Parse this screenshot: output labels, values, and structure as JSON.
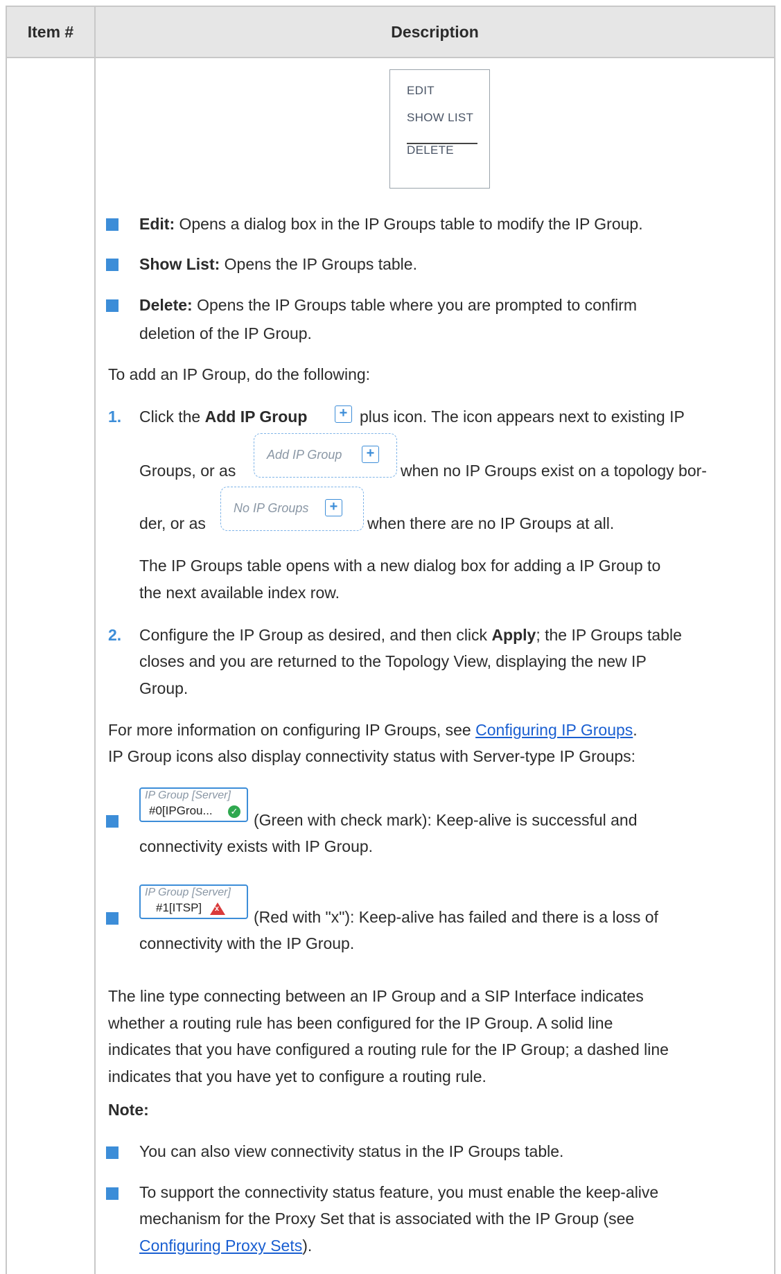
{
  "header": {
    "item": "Item #",
    "description": "Description"
  },
  "menu": {
    "edit": "EDIT",
    "show_list": "SHOW LIST",
    "delete": "DELETE"
  },
  "bullets1": [
    {
      "label": "Edit:",
      "text": " Opens a dialog box in the IP Groups table to modify the IP Group."
    },
    {
      "label": "Show List:",
      "text": " Opens the IP Groups table."
    },
    {
      "label": "Delete:",
      "text": " Opens the IP Groups table where you are prompted to confirm",
      "text2": "deletion of the IP Group."
    }
  ],
  "add_intro": "To add an IP Group, do the following:",
  "step1": {
    "num": "1.",
    "a": "Click the ",
    "bold": "Add IP Group",
    "b": " plus icon. The icon appears next to existing IP",
    "line2a": "Groups, or as",
    "line2b": "when no IP Groups exist on a topology bor-",
    "line3a": "der, or as",
    "line3b": "when there are no IP Groups at all.",
    "add_box_label": "Add IP Group",
    "no_box_label": "No IP Groups",
    "plus": "+",
    "para1": "The IP Groups table opens with a new dialog box for adding a IP Group to",
    "para2": "the next available index row."
  },
  "step2": {
    "num": "2.",
    "a": "Configure the IP Group as desired, and then click ",
    "bold": "Apply",
    "b": "; the IP Groups table",
    "line2": "closes and you are returned to the Topology View, displaying the new IP",
    "line3": "Group."
  },
  "more_info": {
    "text": "For more information on configuring IP Groups, see ",
    "link": "Configuring IP Groups",
    "end": "."
  },
  "icons_intro": "IP Group icons also display connectivity status with Server-type IP Groups:",
  "status": [
    {
      "icon_title": "IP Group [Server]",
      "icon_name": "#0[IPGrou...",
      "text": "(Green with check mark): Keep-alive is successful and",
      "text2": "connectivity exists with IP Group."
    },
    {
      "icon_title": "IP Group [Server]",
      "icon_name": "#1[ITSP]",
      "text": "(Red with \"x\"): Keep-alive has failed and there is a loss of",
      "text2": "connectivity with the IP Group."
    }
  ],
  "line_type": [
    "The line type connecting between an IP Group and a SIP Interface indicates",
    "whether a routing rule has been configured for the IP Group. A solid line",
    "indicates that you have configured a routing rule for the IP Group; a dashed line",
    "indicates that you have yet to configure a routing rule."
  ],
  "note_label": "Note:",
  "notes": [
    {
      "text": "You can also view connectivity status in the IP Groups table."
    },
    {
      "text": "To support the connectivity status feature, you must enable the keep-alive",
      "text2": "mechanism for the Proxy Set that is associated with the IP Group (see",
      "link": "Configuring Proxy Sets",
      "end": ")."
    }
  ],
  "colors": {
    "accent": "#3c8dd8",
    "link": "#1a5fd1",
    "header_bg": "#e6e6e6"
  }
}
